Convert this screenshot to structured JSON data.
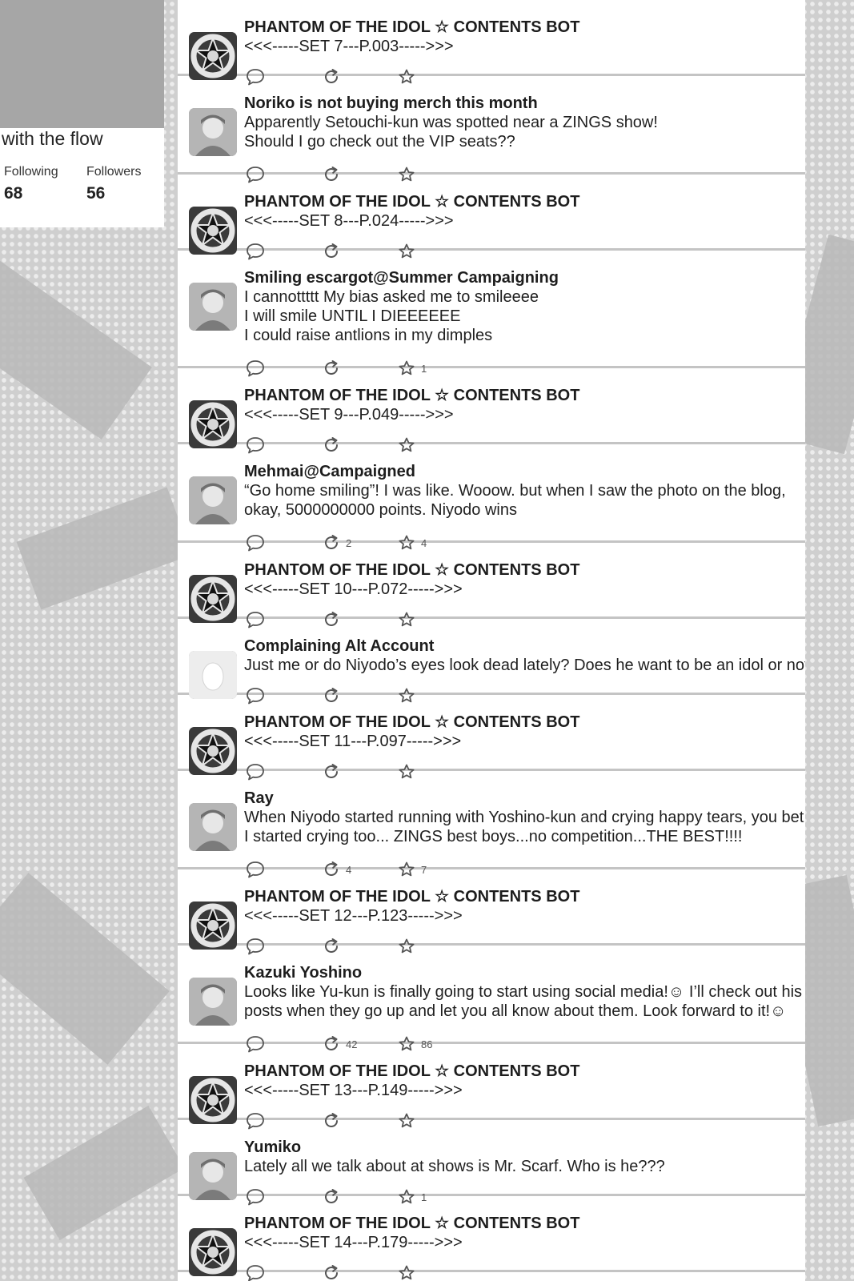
{
  "profile": {
    "bio": "with the flow",
    "following_label": "Following",
    "following_count": "68",
    "followers_label": "Followers",
    "followers_count": "56"
  },
  "icons": {
    "reply": "speech-bubble-icon",
    "retweet": "retweet-icon",
    "favorite": "star-icon"
  },
  "posts": [
    {
      "avatar": "bot",
      "name": "PHANTOM OF THE IDOL ☆ CONTENTS BOT",
      "lines": [
        "<<<-----SET 7---P.003----->>>"
      ],
      "retweets": "",
      "favorites": ""
    },
    {
      "avatar": "user",
      "name": "Noriko is not buying merch this month",
      "lines": [
        "Apparently Setouchi-kun was spotted near a ZINGS show!",
        "Should I go check out the VIP seats??"
      ],
      "retweets": "",
      "favorites": ""
    },
    {
      "avatar": "bot",
      "name": "PHANTOM OF THE IDOL ☆ CONTENTS BOT",
      "lines": [
        "<<<-----SET 8---P.024----->>>"
      ],
      "retweets": "",
      "favorites": ""
    },
    {
      "avatar": "user",
      "name": "Smiling escargot@Summer Campaigning",
      "lines": [
        "I cannottttt My bias asked me to smileeee",
        "I will smile UNTIL I DIEEEEEE",
        "I could raise antlions in my dimples"
      ],
      "retweets": "",
      "favorites": "1"
    },
    {
      "avatar": "bot",
      "name": "PHANTOM OF THE IDOL ☆ CONTENTS BOT",
      "lines": [
        "<<<-----SET 9---P.049----->>>"
      ],
      "retweets": "",
      "favorites": ""
    },
    {
      "avatar": "user",
      "name": "Mehmai@Campaigned",
      "lines": [
        "“Go home smiling”! I was like. Wooow. but when I saw the photo on the blog,",
        "okay, 5000000000 points. Niyodo wins"
      ],
      "retweets": "2",
      "favorites": "4"
    },
    {
      "avatar": "bot",
      "name": "PHANTOM OF THE IDOL ☆ CONTENTS BOT",
      "lines": [
        "<<<-----SET 10---P.072----->>>"
      ],
      "retweets": "",
      "favorites": ""
    },
    {
      "avatar": "egg",
      "name": "Complaining Alt Account",
      "lines": [
        "Just me or do Niyodo’s eyes look dead lately? Does he want to be an idol or not?"
      ],
      "retweets": "",
      "favorites": ""
    },
    {
      "avatar": "bot",
      "name": "PHANTOM OF THE IDOL ☆ CONTENTS BOT",
      "lines": [
        "<<<-----SET 11---P.097----->>>"
      ],
      "retweets": "",
      "favorites": ""
    },
    {
      "avatar": "user",
      "name": "Ray",
      "lines": [
        "When Niyodo started running with Yoshino-kun and crying happy tears, you bet",
        "I started crying too... ZINGS best boys...no competition...THE BEST!!!!"
      ],
      "retweets": "4",
      "favorites": "7"
    },
    {
      "avatar": "bot",
      "name": "PHANTOM OF THE IDOL ☆ CONTENTS BOT",
      "lines": [
        "<<<-----SET 12---P.123----->>>"
      ],
      "retweets": "",
      "favorites": ""
    },
    {
      "avatar": "user",
      "name": "Kazuki Yoshino",
      "lines": [
        "Looks like Yu-kun is finally going to start using social media!☺ I’ll check out his",
        "posts when they go up and let you all know about them. Look forward to it!☺"
      ],
      "retweets": "42",
      "favorites": "86"
    },
    {
      "avatar": "bot",
      "name": "PHANTOM OF THE IDOL ☆ CONTENTS BOT",
      "lines": [
        "<<<-----SET 13---P.149----->>>"
      ],
      "retweets": "",
      "favorites": ""
    },
    {
      "avatar": "user",
      "name": "Yumiko",
      "lines": [
        "Lately all we talk about at shows is Mr. Scarf. Who is he???"
      ],
      "retweets": "",
      "favorites": "1"
    },
    {
      "avatar": "bot",
      "name": "PHANTOM OF THE IDOL ☆ CONTENTS BOT",
      "lines": [
        "<<<-----SET 14---P.179----->>>"
      ],
      "retweets": "",
      "favorites": ""
    }
  ]
}
